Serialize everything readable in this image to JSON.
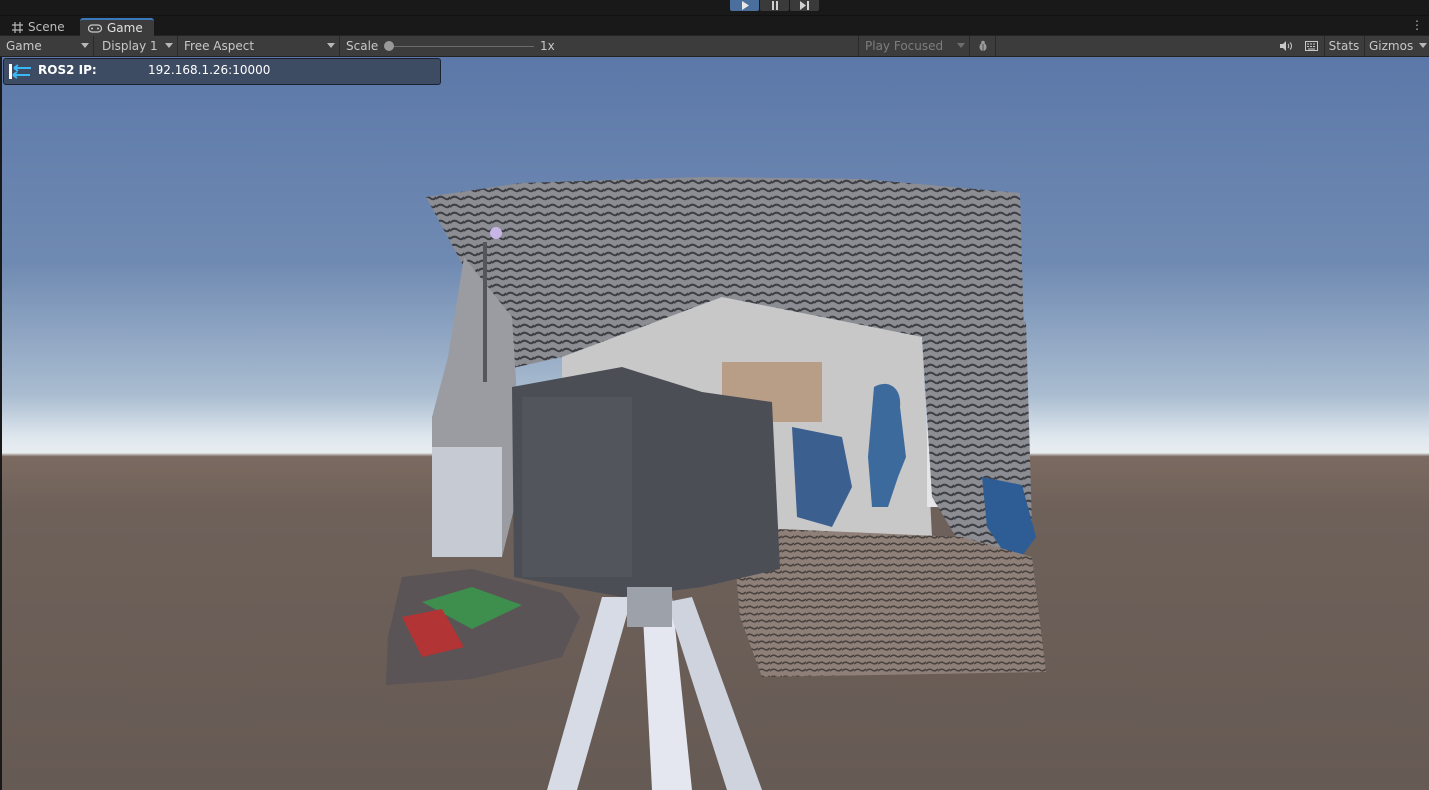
{
  "playbar": {
    "buttons": [
      {
        "name": "play",
        "icon": "play-icon",
        "active": true
      },
      {
        "name": "pause",
        "icon": "pause-icon",
        "active": false
      },
      {
        "name": "step",
        "icon": "step-icon",
        "active": false
      }
    ]
  },
  "tabs": {
    "scene": {
      "label": "Scene",
      "icon": "grid-icon"
    },
    "game": {
      "label": "Game",
      "icon": "gamepad-icon"
    }
  },
  "toolbar": {
    "view_mode": "Game",
    "display": "Display 1",
    "aspect": "Free Aspect",
    "scale_label": "Scale",
    "scale_value": "1x",
    "play_mode": "Play Focused",
    "stats_label": "Stats",
    "gizmos_label": "Gizmos"
  },
  "overlay": {
    "label": "ROS2 IP:",
    "value": "192.168.1.26:10000",
    "icon": "connection-arrows-icon"
  },
  "colors": {
    "accent": "#3a79bb",
    "play_active": "#4a6f9c",
    "overlay_bg": "#3d4b63",
    "sky_top": "#5c78a8",
    "ground": "#6e615a"
  }
}
